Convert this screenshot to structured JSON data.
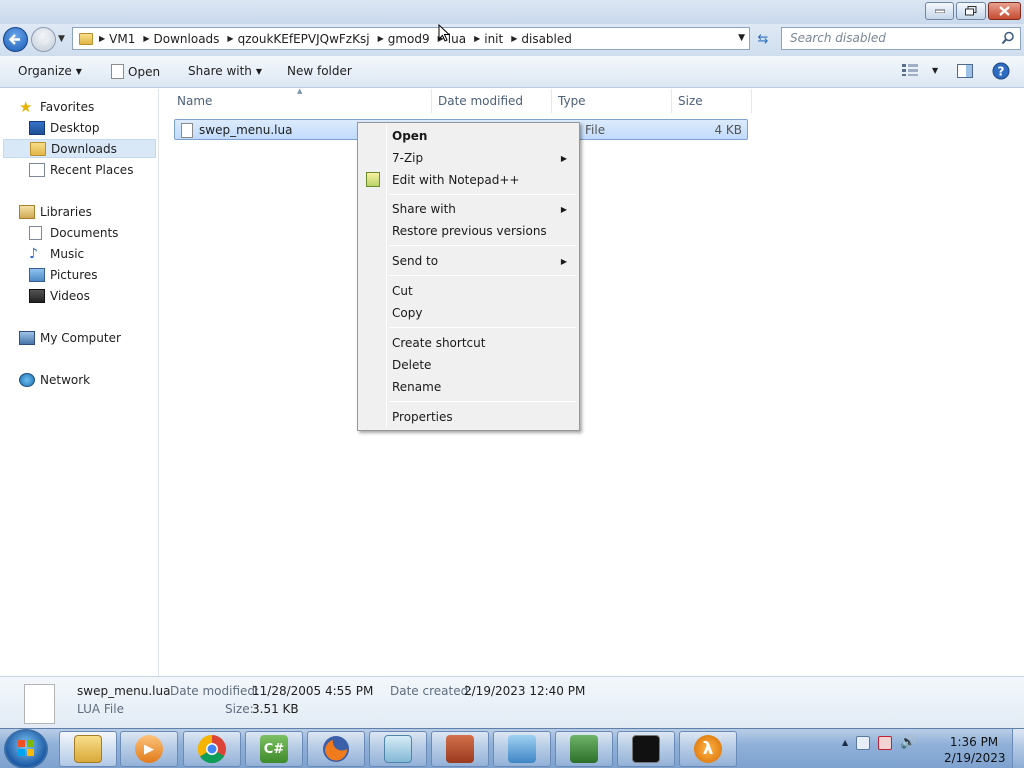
{
  "window": {
    "address": [
      "VM1",
      "Downloads",
      "qzoukKEfEPVJQwFzKsj",
      "gmod9",
      "lua",
      "init",
      "disabled"
    ],
    "search_placeholder": "Search disabled"
  },
  "toolbar": {
    "organize": "Organize",
    "open": "Open",
    "share_with": "Share with",
    "new_folder": "New folder"
  },
  "sidebar": {
    "favorites": "Favorites",
    "desktop": "Desktop",
    "downloads": "Downloads",
    "recent_places": "Recent Places",
    "libraries": "Libraries",
    "documents": "Documents",
    "music": "Music",
    "pictures": "Pictures",
    "videos": "Videos",
    "my_computer": "My Computer",
    "network": "Network"
  },
  "columns": {
    "name": "Name",
    "date_modified": "Date modified",
    "type": "Type",
    "size": "Size"
  },
  "file": {
    "name": "swep_menu.lua",
    "type": "File",
    "size": "4 KB"
  },
  "context_menu": {
    "open": "Open",
    "zip": "7-Zip",
    "notepad": "Edit with Notepad++",
    "share_with": "Share with",
    "restore": "Restore previous versions",
    "send_to": "Send to",
    "cut": "Cut",
    "copy": "Copy",
    "create_shortcut": "Create shortcut",
    "delete": "Delete",
    "rename": "Rename",
    "properties": "Properties"
  },
  "details": {
    "name": "swep_menu.lua",
    "filetype": "LUA File",
    "modified_label": "Date modified:",
    "modified_value": "11/28/2005 4:55 PM",
    "created_label": "Date created:",
    "created_value": "2/19/2023 12:40 PM",
    "size_label": "Size:",
    "size_value": "3.51 KB"
  },
  "taskbar": {
    "csharp_label": "C#",
    "time": "1:36 PM",
    "date": "2/19/2023"
  }
}
